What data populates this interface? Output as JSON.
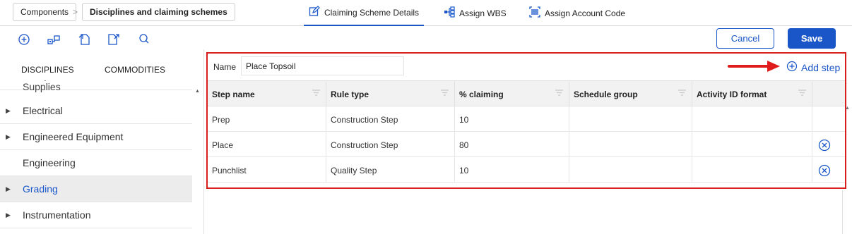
{
  "breadcrumb": {
    "items": [
      "Components",
      "Disciplines and claiming schemes"
    ],
    "separator": ">"
  },
  "tabs": [
    {
      "label": "Claiming Scheme Details",
      "icon": "edit-icon",
      "active": true
    },
    {
      "label": "Assign WBS",
      "icon": "hierarchy-icon",
      "active": false
    },
    {
      "label": "Assign Account Code",
      "icon": "barcode-icon",
      "active": false
    }
  ],
  "toolbar": {
    "icons": [
      "add-circle-icon",
      "structure-icon",
      "import-icon",
      "export-icon",
      "search-icon"
    ],
    "cancel_label": "Cancel",
    "save_label": "Save"
  },
  "sidebar": {
    "tabs": [
      "DISCIPLINES",
      "COMMODITIES"
    ],
    "partial_item": "Discipline Services, Tools and Supplies",
    "items": [
      {
        "label": "Electrical",
        "expandable": true,
        "selected": false
      },
      {
        "label": "Engineered Equipment",
        "expandable": true,
        "selected": false
      },
      {
        "label": "Engineering",
        "expandable": false,
        "selected": false
      },
      {
        "label": "Grading",
        "expandable": true,
        "selected": true
      },
      {
        "label": "Instrumentation",
        "expandable": true,
        "selected": false
      }
    ]
  },
  "form": {
    "name_label": "Name",
    "name_value": "Place Topsoil",
    "add_step_label": "Add step"
  },
  "grid": {
    "columns": [
      "Step name",
      "Rule type",
      "% claiming",
      "Schedule group",
      "Activity ID format"
    ],
    "rows": [
      {
        "step_name": "Prep",
        "rule_type": "Construction Step",
        "claiming": "10",
        "schedule_group": "",
        "activity_id_format": "",
        "removable": false
      },
      {
        "step_name": "Place",
        "rule_type": "Construction Step",
        "claiming": "80",
        "schedule_group": "",
        "activity_id_format": "",
        "removable": true
      },
      {
        "step_name": "Punchlist",
        "rule_type": "Quality Step",
        "claiming": "10",
        "schedule_group": "",
        "activity_id_format": "",
        "removable": true
      }
    ]
  },
  "colors": {
    "accent": "#1a56c8",
    "highlight": "#d91e1e",
    "selected_bg": "#ececec"
  }
}
